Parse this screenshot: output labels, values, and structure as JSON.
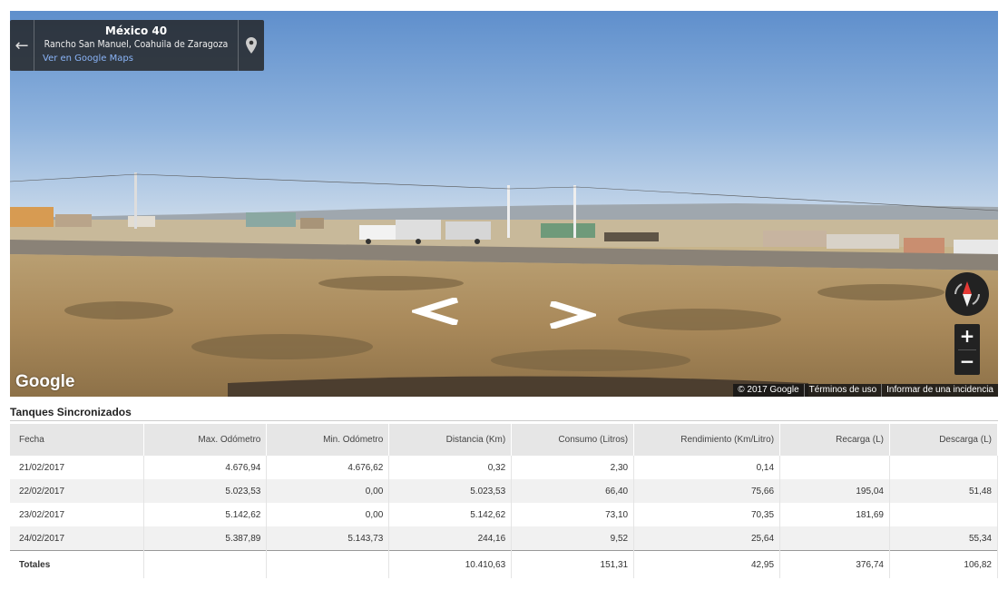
{
  "streetview": {
    "road": "México 40",
    "place": "Rancho San Manuel, Coahuila de Zaragoza",
    "maps_link": "Ver en Google Maps",
    "logo": "Google",
    "attribution": {
      "copyright": "© 2017 Google",
      "terms": "Términos de uso",
      "report": "Informar de una incidencia"
    },
    "zoom_in": "+",
    "zoom_out": "−",
    "icons": {
      "back": "back-arrow-icon",
      "pin": "location-pin-icon",
      "compass": "compass-icon"
    }
  },
  "table": {
    "title": "Tanques Sincronizados",
    "columns": [
      "Fecha",
      "Max. Odómetro",
      "Min. Odómetro",
      "Distancia (Km)",
      "Consumo (Litros)",
      "Rendimiento  (Km/Litro)",
      "Recarga (L)",
      "Descarga (L)"
    ],
    "rows": [
      [
        "21/02/2017",
        "4.676,94",
        "4.676,62",
        "0,32",
        "2,30",
        "0,14",
        "",
        ""
      ],
      [
        "22/02/2017",
        "5.023,53",
        "0,00",
        "5.023,53",
        "66,40",
        "75,66",
        "195,04",
        "51,48"
      ],
      [
        "23/02/2017",
        "5.142,62",
        "0,00",
        "5.142,62",
        "73,10",
        "70,35",
        "181,69",
        ""
      ],
      [
        "24/02/2017",
        "5.387,89",
        "5.143,73",
        "244,16",
        "9,52",
        "25,64",
        "",
        "55,34"
      ]
    ],
    "totals": {
      "label": "Totales",
      "distancia": "10.410,63",
      "consumo": "151,31",
      "rendimiento": "42,95",
      "recarga": "376,74",
      "descarga": "106,82"
    }
  }
}
